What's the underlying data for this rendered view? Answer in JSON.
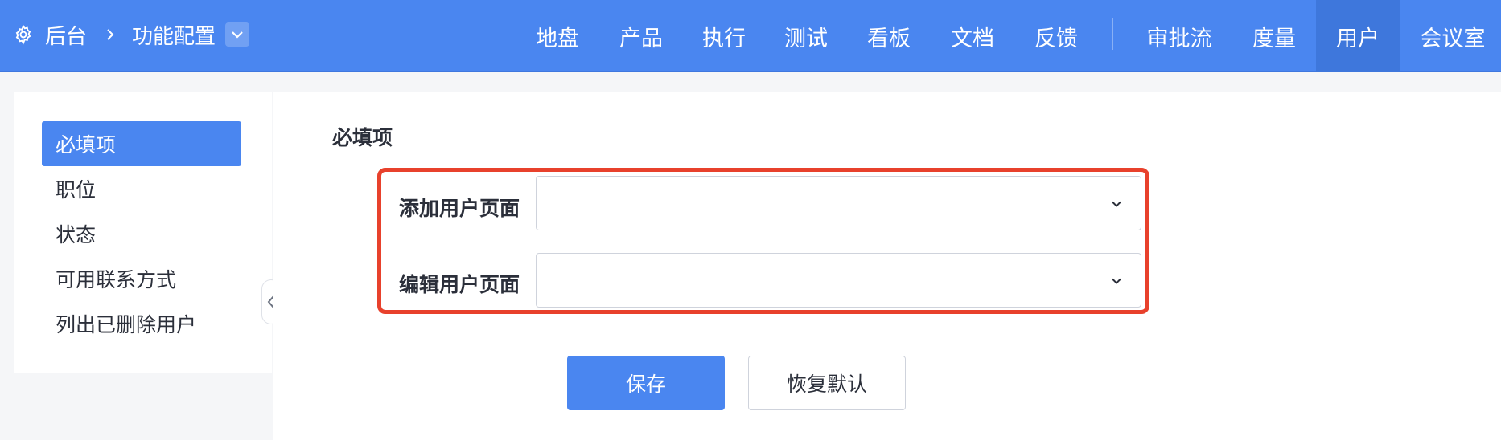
{
  "breadcrumb": {
    "home_icon": "gear-icon",
    "root": "后台",
    "current": "功能配置"
  },
  "nav": {
    "items": [
      "地盘",
      "产品",
      "执行",
      "测试",
      "看板",
      "文档",
      "反馈",
      "审批流",
      "度量",
      "用户",
      "会议室"
    ],
    "active": "用户"
  },
  "sidebar": {
    "items": [
      "必填项",
      "职位",
      "状态",
      "可用联系方式",
      "列出已删除用户"
    ],
    "active": "必填项"
  },
  "form": {
    "title": "必填项",
    "fields": [
      {
        "label": "添加用户页面",
        "value": ""
      },
      {
        "label": "编辑用户页面",
        "value": ""
      }
    ]
  },
  "actions": {
    "save": "保存",
    "reset": "恢复默认"
  },
  "colors": {
    "brand": "#4a86f0",
    "active_nav": "#3e77dc",
    "highlight": "#e8412c"
  }
}
